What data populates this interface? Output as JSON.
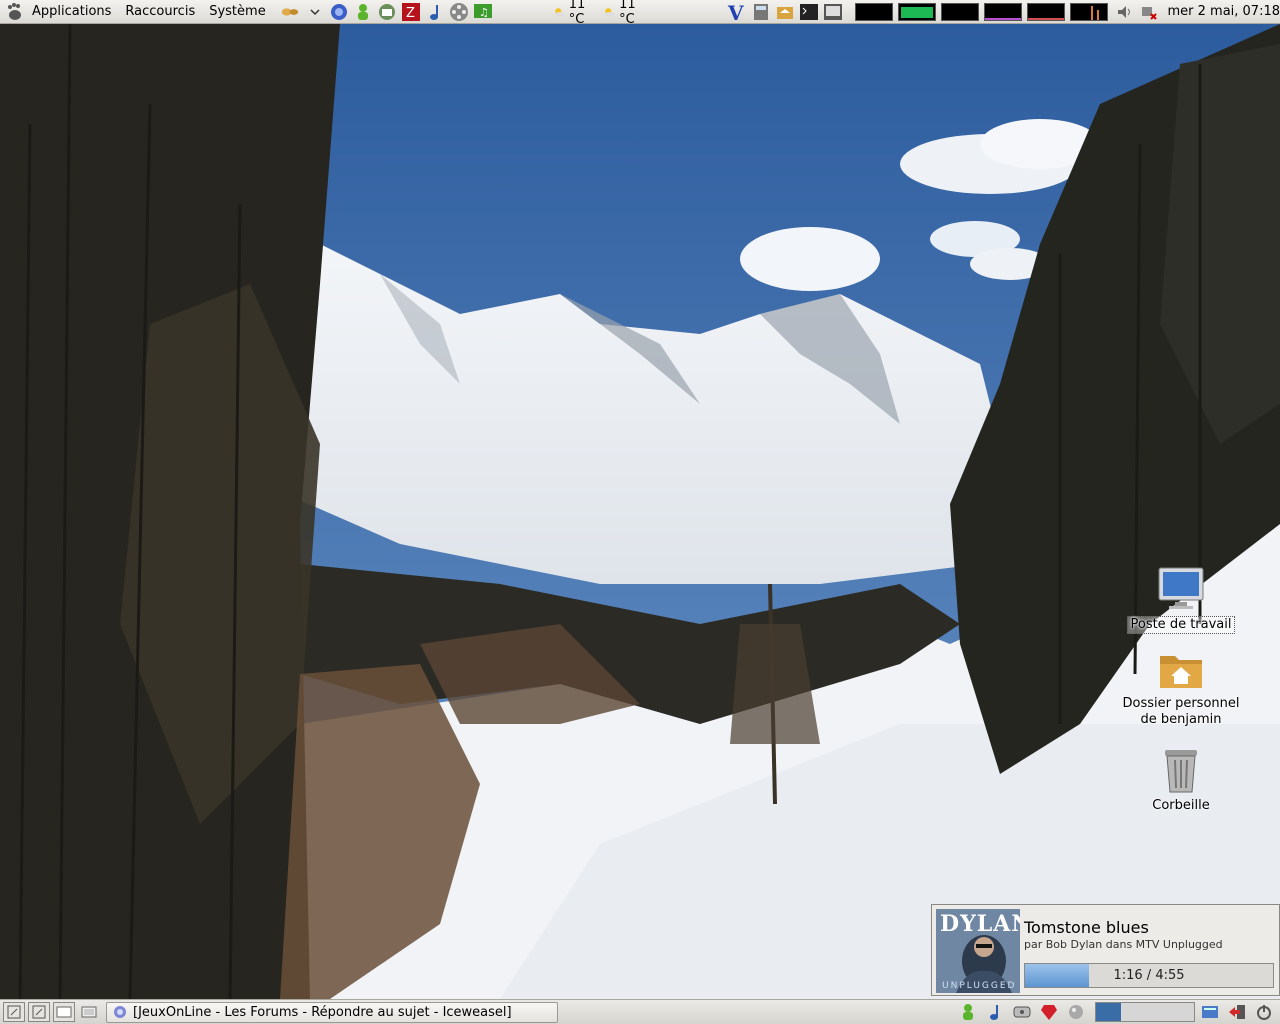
{
  "top_panel": {
    "menu": {
      "applications": "Applications",
      "shortcuts": "Raccourcis",
      "system": "Système"
    },
    "weather": [
      {
        "temp": "11 °C",
        "icon": "sun-cloud-icon"
      },
      {
        "temp": "11 °C",
        "icon": "sun-cloud-icon"
      }
    ],
    "clock": "mer  2 mai, 07:18"
  },
  "desktop_icons": {
    "computer": "Poste de travail",
    "home_line1": "Dossier personnel",
    "home_line2": "de benjamin",
    "trash": "Corbeille"
  },
  "notification": {
    "title": "Tomstone blues",
    "subtitle": "par Bob Dylan dans MTV Unplugged",
    "album_text_top": "DYLAN",
    "album_text_bottom": "UNPLUGGED",
    "progress_text": "1:16 / 4:55",
    "progress_fraction": 0.258
  },
  "taskbar": {
    "window_title": "[JeuxOnLine - Les Forums - Répondre au sujet - Iceweasel]"
  },
  "colors": {
    "sky": "#3d6aa6",
    "panel": "#e4e2de",
    "progress": "#5d95d1"
  }
}
